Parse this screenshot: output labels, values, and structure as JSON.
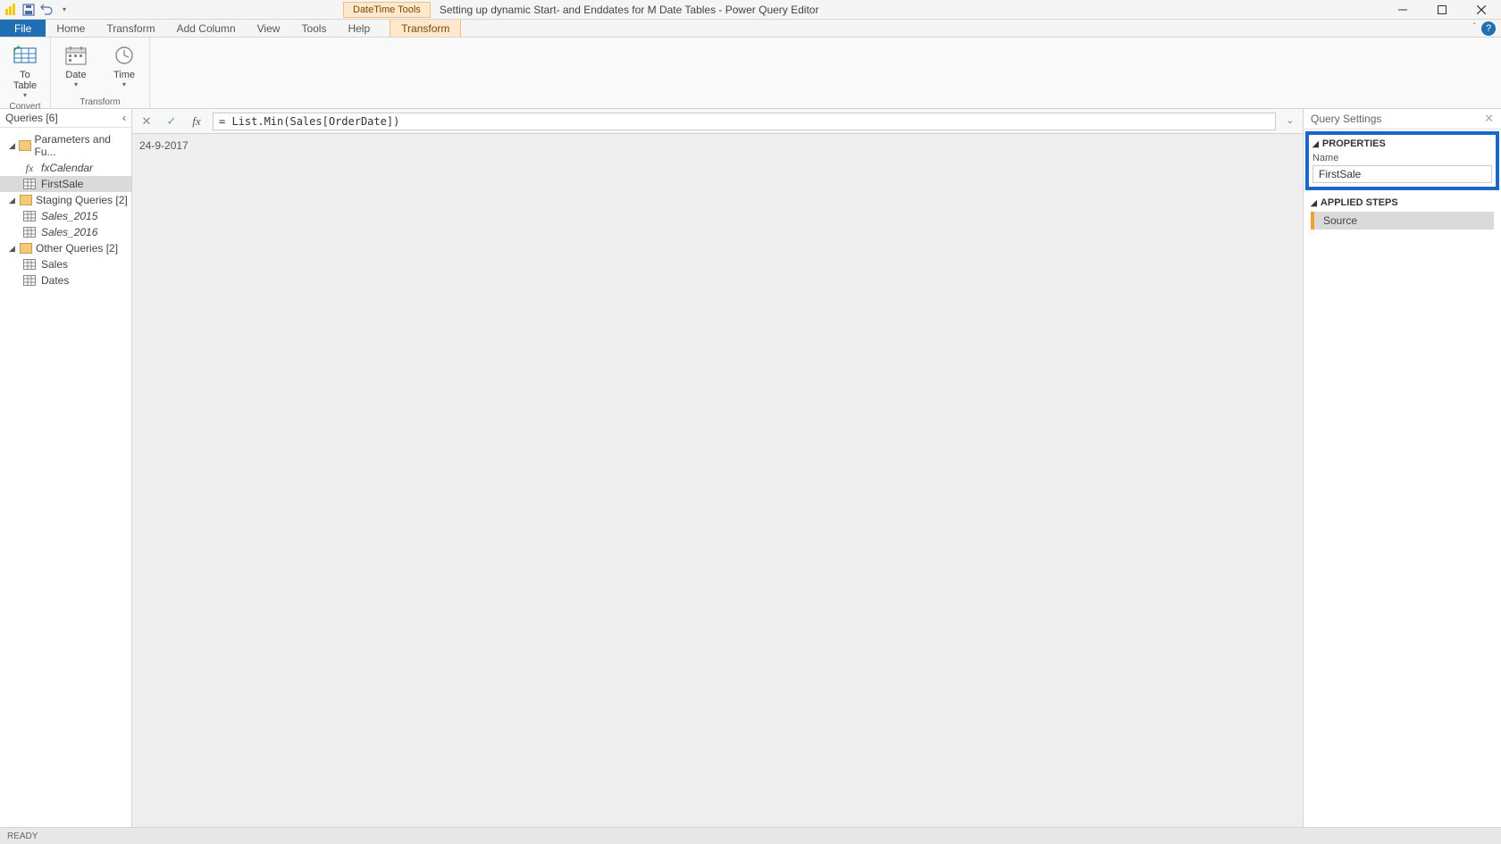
{
  "titlebar": {
    "context_tool": "DateTime Tools",
    "window_title": "Setting up dynamic Start- and Enddates for M Date Tables - Power Query Editor"
  },
  "tabs": {
    "file": "File",
    "home": "Home",
    "transform": "Transform",
    "add_column": "Add Column",
    "view": "View",
    "tools": "Tools",
    "help": "Help",
    "context_transform": "Transform"
  },
  "ribbon": {
    "to_table": "To\nTable",
    "date": "Date",
    "time": "Time",
    "group_convert": "Convert",
    "group_transform": "Transform"
  },
  "queries": {
    "header": "Queries [6]",
    "group_params": "Parameters and Fu...",
    "fx_calendar": "fxCalendar",
    "first_sale": "FirstSale",
    "group_staging": "Staging Queries [2]",
    "sales_2015": "Sales_2015",
    "sales_2016": "Sales_2016",
    "group_other": "Other Queries [2]",
    "sales": "Sales",
    "dates": "Dates"
  },
  "formula": {
    "text": "= List.Min(Sales[OrderDate])"
  },
  "result": {
    "value": "24-9-2017"
  },
  "settings": {
    "header": "Query Settings",
    "properties": "PROPERTIES",
    "name_label": "Name",
    "name_value": "FirstSale",
    "applied_steps": "APPLIED STEPS",
    "step_source": "Source"
  },
  "status": {
    "ready": "READY"
  }
}
